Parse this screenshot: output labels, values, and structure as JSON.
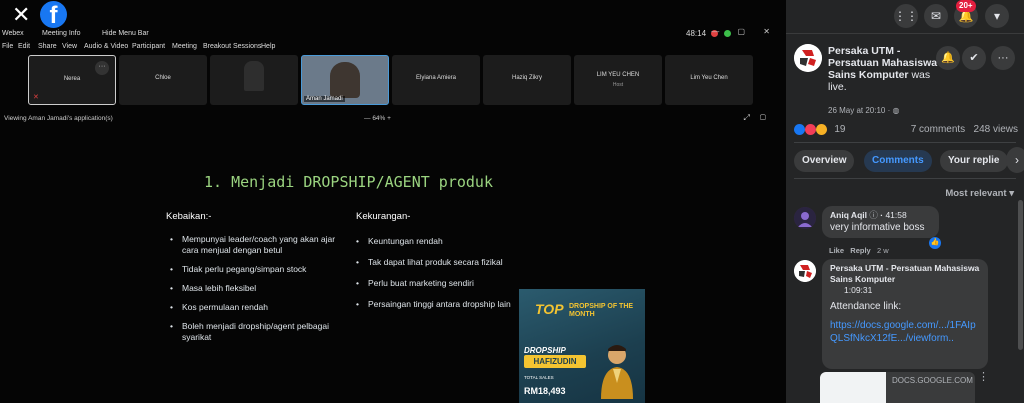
{
  "webex": {
    "app_label": "Webex",
    "meeting_info": "Meeting Info",
    "hide_menu": "Hide Menu Bar",
    "timer": "48:14",
    "menu": [
      "File",
      "Edit",
      "Share",
      "View",
      "Audio & Video",
      "Participant",
      "Meeting",
      "Breakout Sessions",
      "Help"
    ],
    "participants": [
      {
        "name": "Nerea"
      },
      {
        "name": "Chloe"
      },
      {
        "name": ""
      },
      {
        "name": "Aman Jamadi"
      },
      {
        "name": "Elyiana Amiera"
      },
      {
        "name": "Haziq Zikry"
      },
      {
        "name": "LIM YEU CHEN",
        "sub": "Host"
      },
      {
        "name": "Lim Yeu Chen"
      }
    ],
    "viewing": "Viewing Aman Jamadi's application(s)",
    "zoom": "64%"
  },
  "slide": {
    "title": "1. Menjadi DROPSHIP/AGENT produk",
    "left_heading": "Kebaikan:-",
    "right_heading": "Kekurangan-",
    "left_items": [
      "Mempunyai leader/coach yang akan ajar cara menjual dengan betul",
      "Tidak perlu pegang/simpan stock",
      "Masa lebih fleksibel",
      "Kos permulaan rendah",
      "Boleh menjadi dropship/agent pelbagai syarikat"
    ],
    "right_items": [
      "Keuntungan rendah",
      "Tak dapat lihat produk secara fizikal",
      "Perlu buat marketing sendiri",
      "Persaingan tinggi antara dropship lain"
    ],
    "promo": {
      "top": "TOP",
      "subtitle": "DROPSHIP OF THE MONTH",
      "dropship": "DROPSHIP",
      "name": "HAFIZUDIN",
      "total_label": "TOTAL SALES",
      "amount": "RM18,493"
    }
  },
  "facebook": {
    "notif_badge": "20+",
    "page_name": "Persaka UTM - Persatuan Mahasiswa Sains Komputer",
    "live_text": "was live.",
    "date": "26 May at 20:10 · ",
    "reaction_count": "19",
    "comments_count": "7 comments",
    "views_count": "248 views",
    "tabs": [
      "Overview",
      "Comments",
      "Your replie"
    ],
    "sort_label": "Most relevant",
    "comments": [
      {
        "author": "Aniq Aqil",
        "time": "41:58",
        "text": "very informative boss",
        "like": "Like",
        "reply": "Reply",
        "age": "2 w"
      },
      {
        "author": "Persaka UTM - Persatuan Mahasiswa Sains Komputer",
        "time": "1:09:31",
        "text": "Attendance link:",
        "link": "https://docs.google.com/.../1FAIpQLSfNkcX12fE.../viewform.."
      }
    ],
    "preview_domain": "DOCS.GOOGLE.COM"
  },
  "colors": {
    "fb_blue": "#1877f2",
    "fb_bg": "#242526",
    "slide_title": "#9bd480",
    "link": "#4599ff"
  }
}
